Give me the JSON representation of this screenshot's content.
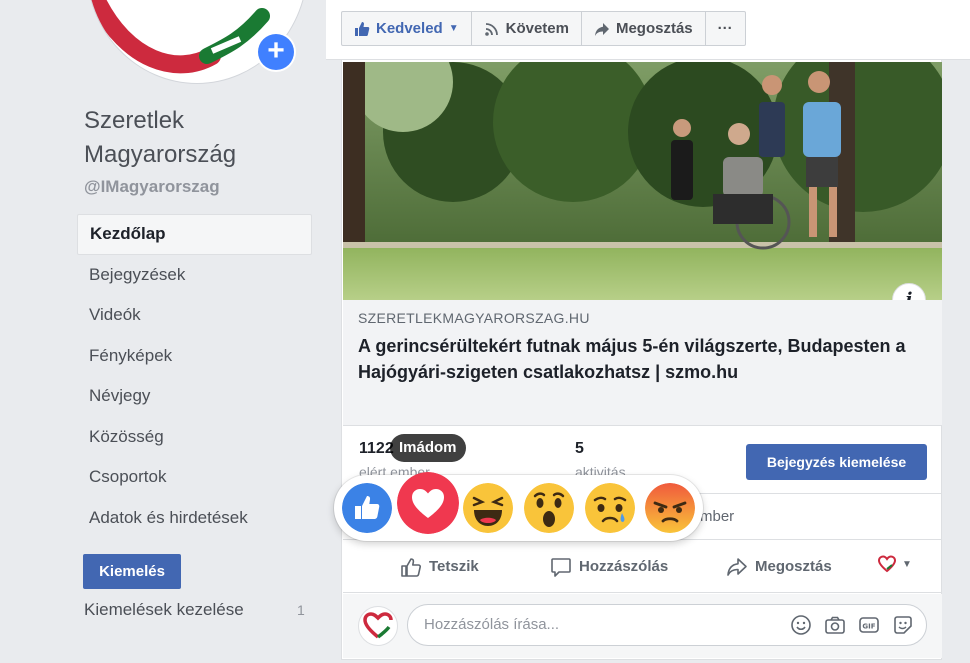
{
  "page": {
    "name": "Szeretlek Magyarország",
    "handle": "@IMagyarorszag"
  },
  "sidebar": {
    "items": [
      {
        "label": "Kezdőlap",
        "active": true
      },
      {
        "label": "Bejegyzések"
      },
      {
        "label": "Videók"
      },
      {
        "label": "Fényképek"
      },
      {
        "label": "Névjegy"
      },
      {
        "label": "Közösség"
      },
      {
        "label": "Csoportok"
      },
      {
        "label": "Adatok és hirdetések"
      }
    ],
    "promote_label": "Kiemelés",
    "manage_promotions_label": "Kiemelések kezelése",
    "manage_promotions_count": "1"
  },
  "actionbar": {
    "like_label": "Kedveled",
    "follow_label": "Követem",
    "share_label": "Megosztás",
    "more_label": "···"
  },
  "post": {
    "link_domain": "SZERETLEKMAGYARORSZAG.HU",
    "link_title": "A gerincsérültekért futnak május 5-én világszerte, Budapesten a Hajógyári-szigeten csatlakozhatsz | szmo.hu",
    "info_icon": "i",
    "stats": {
      "reached_value": "1122",
      "reached_label": "elért ember",
      "engagement_value": "5",
      "engagement_label": "aktivitás"
    },
    "boost_label": "Bejegyzés kiemelése",
    "reach_text_visible": "mber",
    "actions": {
      "like": "Tetszik",
      "comment": "Hozzászólás",
      "share": "Megosztás"
    },
    "comment_placeholder": "Hozzászólás írása..."
  },
  "reactions": {
    "tooltip": "Imádom",
    "items": [
      "like",
      "love",
      "haha",
      "wow",
      "sad",
      "angry"
    ],
    "colors": {
      "like": "#3b82e6",
      "love": "#f0384f",
      "face": "#f9c43a",
      "angry_top": "#f05a3c"
    }
  },
  "colors": {
    "brand_blue": "#4267b2",
    "page_bg": "#e9ebee",
    "accent_plus": "#4080ff"
  },
  "icons": [
    "plus-icon",
    "thumbs-up-icon",
    "rss-icon",
    "share-arrow-icon",
    "more-dots-icon",
    "info-icon",
    "comment-bubble-icon",
    "emoji-icon",
    "camera-icon",
    "gif-icon",
    "sticker-icon",
    "caret-down-icon"
  ]
}
